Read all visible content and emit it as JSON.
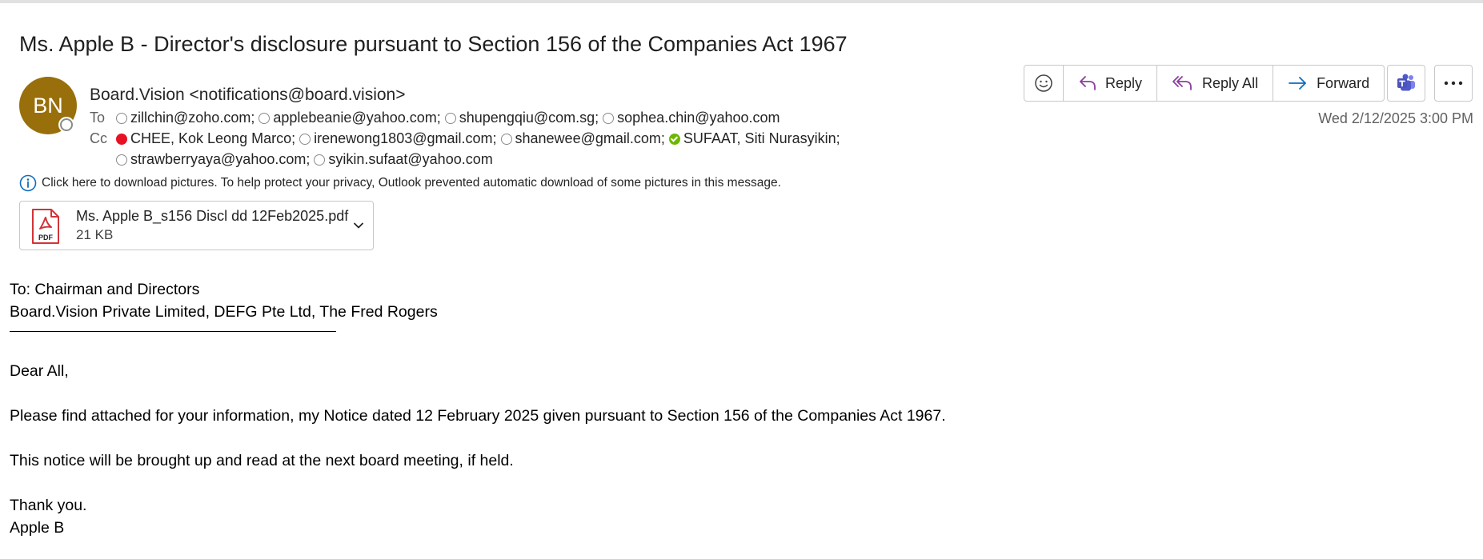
{
  "subject": "Ms. Apple B - Director's disclosure pursuant to Section 156 of the Companies Act 1967",
  "sender": {
    "initials": "BN",
    "display": "Board.Vision <notifications@board.vision>",
    "avatar_color": "#986f0b"
  },
  "recipients": {
    "to_label": "To",
    "cc_label": "Cc",
    "to": [
      {
        "text": "zillchin@zoho.com;",
        "status": "away"
      },
      {
        "text": "applebeanie@yahoo.com;",
        "status": "away"
      },
      {
        "text": "shupengqiu@com.sg;",
        "status": "away"
      },
      {
        "text": "sophea.chin@yahoo.com",
        "status": "away"
      }
    ],
    "cc_line1": [
      {
        "text": "CHEE, Kok Leong Marco;",
        "status": "busy"
      },
      {
        "text": "irenewong1803@gmail.com;",
        "status": "away"
      },
      {
        "text": "shanewee@gmail.com;",
        "status": "away"
      },
      {
        "text": "SUFAAT, Siti Nurasyikin;",
        "status": "available"
      }
    ],
    "cc_line2": [
      {
        "text": "strawberryaya@yahoo.com;",
        "status": "away"
      },
      {
        "text": "syikin.sufaat@yahoo.com",
        "status": "away"
      }
    ]
  },
  "toolbar": {
    "emoji_icon": "emoji-smile-icon",
    "reply": "Reply",
    "reply_all": "Reply All",
    "forward": "Forward",
    "teams_icon": "teams-icon",
    "more_icon": "more-ellipsis-icon",
    "accent_reply": "#8a3e9e",
    "accent_forward": "#0f6cbd"
  },
  "date": "Wed 2/12/2025 3:00 PM",
  "infobar": {
    "icon": "info-icon",
    "text": "Click here to download pictures. To help protect your privacy, Outlook prevented automatic download of some pictures in this message."
  },
  "attachment": {
    "icon": "pdf-icon",
    "icon_label": "PDF",
    "name": "Ms. Apple B_s156 Discl dd 12Feb2025.pdf",
    "size": "21 KB"
  },
  "body": {
    "to_line": "To: Chairman and Directors",
    "companies": "Board.Vision Private Limited, DEFG Pte Ltd, The Fred Rogers",
    "greeting": "Dear All,",
    "para1": "Please find attached for your information, my Notice dated 12 February 2025 given pursuant to Section 156 of the Companies Act 1967.",
    "para2": "This notice will be brought up and read at the next board meeting, if held.",
    "closing": "Thank you.",
    "signature": "Apple B"
  }
}
